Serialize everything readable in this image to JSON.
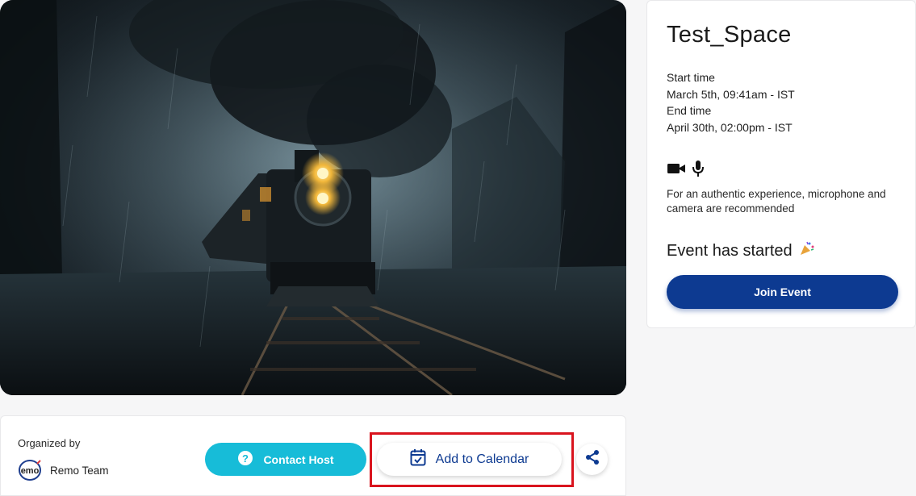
{
  "event": {
    "title": "Test_Space",
    "start_label": "Start time",
    "start_value": "March 5th, 09:41am - IST",
    "end_label": "End time",
    "end_value": "April 30th, 02:00pm - IST",
    "media_note": "For an authentic experience, microphone and camera are recommended",
    "status": "Event has started",
    "join_label": "Join Event"
  },
  "organizer": {
    "label": "Organized by",
    "name": "Remo Team",
    "logo_text": "emo"
  },
  "actions": {
    "contact_label": "Contact Host",
    "calendar_label": "Add to Calendar"
  },
  "icons": {
    "camera": "video-camera-icon",
    "mic": "microphone-icon",
    "party": "party-popper-icon",
    "help": "question-circle-icon",
    "calendar": "calendar-check-icon",
    "share": "share-icon"
  },
  "colors": {
    "primary": "#0d3a91",
    "contact": "#17bcd8",
    "highlight": "#d9141e"
  }
}
